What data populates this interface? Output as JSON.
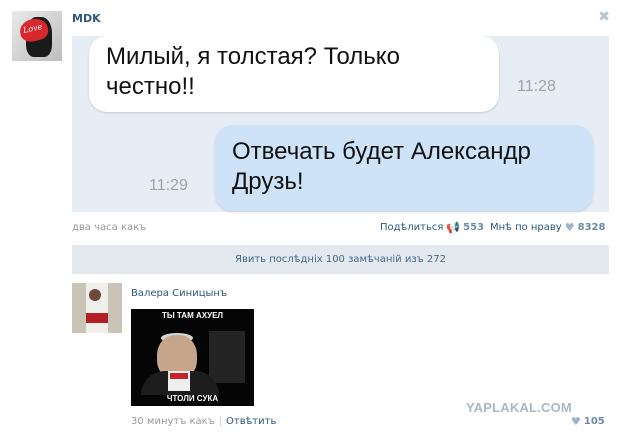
{
  "post": {
    "author": "MDK",
    "close_icon": "close-icon",
    "avatar_text": "Love",
    "time": "два часа какъ"
  },
  "chat": {
    "incoming_text": "Милый, я толстая? Только честно!!",
    "incoming_time": "11:28",
    "outgoing_text": "Отвечать будет Александр Друзь!",
    "outgoing_time": "11:29"
  },
  "actions": {
    "share_label": "Подѣлиться",
    "share_count": "553",
    "like_label": "Мнѣ по нраву",
    "like_count": "8328"
  },
  "comments_bar": {
    "label": "Явить послѣднiх 100 замѣчанiй изъ 272"
  },
  "comment": {
    "author": "Валера Синицынъ",
    "meme_top": "ТЫ ТАМ АХУЕЛ",
    "meme_bottom": "ЧТОЛИ СУКА",
    "time": "30 минутъ какъ",
    "reply_label": "Отвѣтить",
    "separator": "|",
    "like_count": "105"
  },
  "watermark": "YAPLAKAL.COM",
  "icons": {
    "close": "close-icon",
    "share": "megaphone-icon",
    "like": "heart-icon"
  }
}
